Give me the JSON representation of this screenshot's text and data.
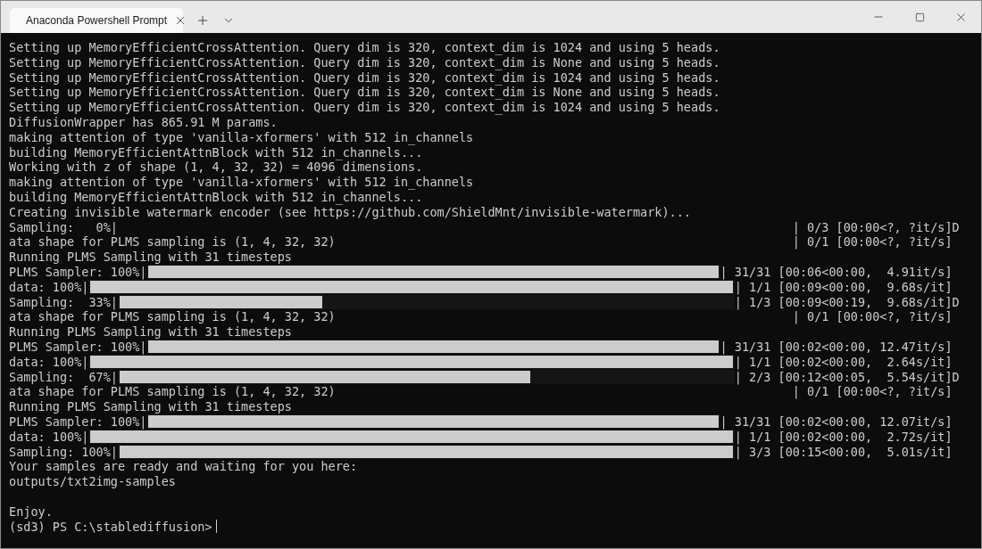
{
  "window": {
    "tab": {
      "title": "Anaconda Powershell Prompt",
      "selected": true
    }
  },
  "terminal": {
    "lines": [
      {
        "kind": "text",
        "text": "Setting up MemoryEfficientCrossAttention. Query dim is 320, context_dim is 1024 and using 5 heads."
      },
      {
        "kind": "text",
        "text": "Setting up MemoryEfficientCrossAttention. Query dim is 320, context_dim is None and using 5 heads."
      },
      {
        "kind": "text",
        "text": "Setting up MemoryEfficientCrossAttention. Query dim is 320, context_dim is 1024 and using 5 heads."
      },
      {
        "kind": "text",
        "text": "Setting up MemoryEfficientCrossAttention. Query dim is 320, context_dim is None and using 5 heads."
      },
      {
        "kind": "text",
        "text": "Setting up MemoryEfficientCrossAttention. Query dim is 320, context_dim is 1024 and using 5 heads."
      },
      {
        "kind": "text",
        "text": "DiffusionWrapper has 865.91 M params."
      },
      {
        "kind": "text",
        "text": "making attention of type 'vanilla-xformers' with 512 in_channels"
      },
      {
        "kind": "text",
        "text": "building MemoryEfficientAttnBlock with 512 in_channels..."
      },
      {
        "kind": "text",
        "text": "Working with z of shape (1, 4, 32, 32) = 4096 dimensions."
      },
      {
        "kind": "text",
        "text": "making attention of type 'vanilla-xformers' with 512 in_channels"
      },
      {
        "kind": "text",
        "text": "building MemoryEfficientAttnBlock with 512 in_channels..."
      },
      {
        "kind": "text",
        "text": "Creating invisible watermark encoder (see https://github.com/ShieldMnt/invisible-watermark)..."
      },
      {
        "kind": "progress",
        "label": "Sampling:   0%|",
        "stats": "| 0/3 [00:00<?, ?it/s]",
        "tail": "D"
      },
      {
        "kind": "progress",
        "label": "ata shape for PLMS sampling is (1, 4, 32, 32)",
        "stats": "| 0/1 [00:00<?, ?it/s]"
      },
      {
        "kind": "text",
        "text": "Running PLMS Sampling with 31 timesteps"
      },
      {
        "kind": "progress",
        "label": "PLMS Sampler: 100%|",
        "level": 1,
        "stats": "| 31/31 [00:06<00:00,  4.91it/s]"
      },
      {
        "kind": "progress",
        "label": "data: 100%|",
        "level": 1,
        "stats": "| 1/1 [00:09<00:00,  9.68s/it]"
      },
      {
        "kind": "progress",
        "label": "Sampling:  33%|",
        "level": 0.33,
        "stats": "| 1/3 [00:09<00:19,  9.68s/it]",
        "tail": "D"
      },
      {
        "kind": "progress",
        "label": "ata shape for PLMS sampling is (1, 4, 32, 32)",
        "stats": "| 0/1 [00:00<?, ?it/s]"
      },
      {
        "kind": "text",
        "text": "Running PLMS Sampling with 31 timesteps"
      },
      {
        "kind": "progress",
        "label": "PLMS Sampler: 100%|",
        "level": 1,
        "stats": "| 31/31 [00:02<00:00, 12.47it/s]"
      },
      {
        "kind": "progress",
        "label": "data: 100%|",
        "level": 1,
        "stats": "| 1/1 [00:02<00:00,  2.64s/it]"
      },
      {
        "kind": "progress",
        "label": "Sampling:  67%|",
        "level": 0.67,
        "stats": "| 2/3 [00:12<00:05,  5.54s/it]",
        "tail": "D"
      },
      {
        "kind": "progress",
        "label": "ata shape for PLMS sampling is (1, 4, 32, 32)",
        "stats": "| 0/1 [00:00<?, ?it/s]"
      },
      {
        "kind": "text",
        "text": "Running PLMS Sampling with 31 timesteps"
      },
      {
        "kind": "progress",
        "label": "PLMS Sampler: 100%|",
        "level": 1,
        "stats": "| 31/31 [00:02<00:00, 12.07it/s]"
      },
      {
        "kind": "progress",
        "label": "data: 100%|",
        "level": 1,
        "stats": "| 1/1 [00:02<00:00,  2.72s/it]"
      },
      {
        "kind": "progress",
        "label": "Sampling: 100%|",
        "level": 1,
        "stats": "| 3/3 [00:15<00:00,  5.01s/it]"
      },
      {
        "kind": "text",
        "text": "Your samples are ready and waiting for you here:"
      },
      {
        "kind": "text",
        "text": "outputs/txt2img-samples"
      },
      {
        "kind": "blank"
      },
      {
        "kind": "text",
        "text": "Enjoy."
      },
      {
        "kind": "prompt",
        "text": "(sd3) PS C:\\stablediffusion>"
      }
    ]
  }
}
